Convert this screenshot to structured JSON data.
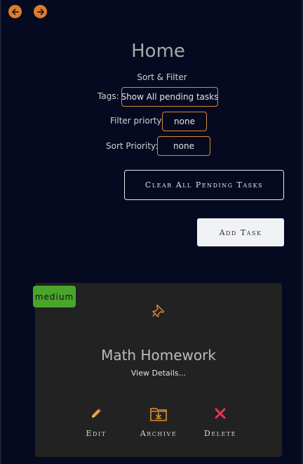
{
  "nav": {
    "back_icon": "arrow-left-icon",
    "forward_icon": "arrow-right-icon",
    "accent": "#e07a2c"
  },
  "header": {
    "title": "Home",
    "section_label": "Sort & Filter"
  },
  "filters": {
    "tags_label": "Tags:",
    "tags_value": "Show All pending tasks",
    "priority_filter_label": "Filter priorty:",
    "priority_filter_value": "none",
    "sort_label": "Sort Priority:",
    "sort_value": "none",
    "border_color": "#d58a3a"
  },
  "actions": {
    "clear_label": "Clear All Pending Tasks",
    "add_label": "Add Task"
  },
  "task": {
    "priority": "medium",
    "priority_color": "#4aa52b",
    "pin_icon": "pin-icon",
    "title": "Math Homework",
    "details_link": "View Details...",
    "edit_label": "Edit",
    "archive_label": "Archive",
    "delete_label": "Delete",
    "edit_icon": "pencil-icon",
    "archive_icon": "archive-folder-icon",
    "delete_icon": "close-x-icon",
    "delete_color": "#e8335a"
  }
}
